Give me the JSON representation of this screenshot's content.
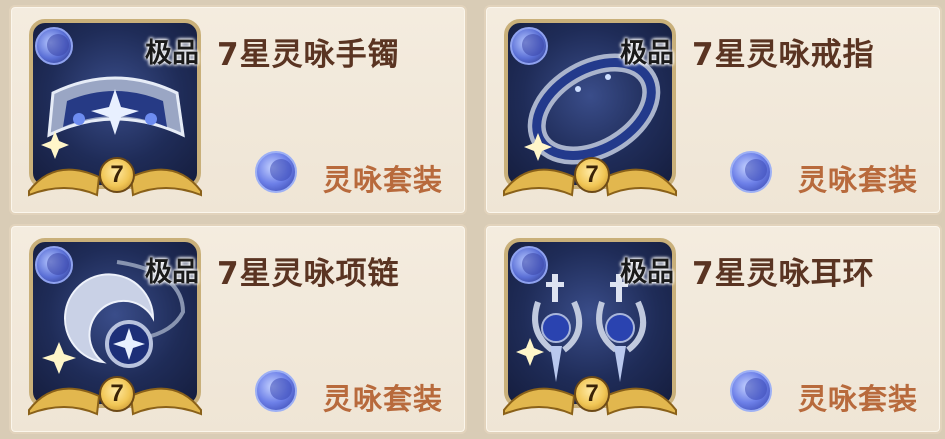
{
  "cards": [
    {
      "quality": "极品",
      "name": "7星灵咏手镯",
      "stars": "7",
      "set": "灵咏套装",
      "item": "bracelet"
    },
    {
      "quality": "极品",
      "name": "7星灵咏戒指",
      "stars": "7",
      "set": "灵咏套装",
      "item": "ring"
    },
    {
      "quality": "极品",
      "name": "7星灵咏项链",
      "stars": "7",
      "set": "灵咏套装",
      "item": "necklace"
    },
    {
      "quality": "极品",
      "name": "7星灵咏耳环",
      "stars": "7",
      "set": "灵咏套装",
      "item": "earrings"
    }
  ],
  "colors": {
    "name": "#5a3422",
    "set_label": "#b86a3c",
    "card_bg": "#f4ecdf",
    "icon_bg": "#1f2c58"
  }
}
